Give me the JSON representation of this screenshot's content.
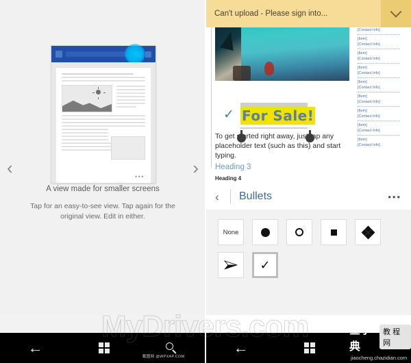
{
  "left_panel": {
    "tour": {
      "caption": "A view made for smaller screens",
      "subtext": "Tap for an easy-to-see view. Tap again for the original view. Edit in either.",
      "prev_arrow": "‹",
      "next_arrow": "›",
      "device_overflow": "•••"
    },
    "navbar": {
      "back": "←",
      "start_icon": "windows-icon",
      "search_icon": "search-icon"
    },
    "watermark_small": "截图网 @WPXAP.COM"
  },
  "right_panel": {
    "notification": {
      "message": "Can't upload - Please sign into...",
      "expand_icon": "chevron-down-icon"
    },
    "document": {
      "title_text": "For Sale!",
      "bullet_glyph": "✓",
      "body_text": "To get started right away, just tap any placeholder text (such as this) and start typing.",
      "heading3": "Heading 3",
      "heading4": "Heading 4",
      "sidebar_entries": [
        "[Contact Info]",
        "[Item]",
        "[Contact Info]",
        "[Item]",
        "[Contact Info]",
        "[Item]",
        "[Contact Info]",
        "[Item]",
        "[Contact Info]",
        "[Item]",
        "[Contact Info]",
        "[Item]",
        "[Contact Info]",
        "[Item]",
        "[Contact Info]",
        "[Item]",
        "[Contact Info]"
      ]
    },
    "bullets_pane": {
      "back_icon": "‹",
      "title": "Bullets",
      "overflow": "•••",
      "options_row1": [
        {
          "label": "None",
          "icon": "none-option"
        },
        {
          "label": "",
          "icon": "filled-circle-bullet"
        },
        {
          "label": "",
          "icon": "hollow-circle-bullet"
        },
        {
          "label": "",
          "icon": "filled-square-bullet"
        },
        {
          "label": "",
          "icon": "diamond-cluster-bullet"
        }
      ],
      "options_row2": [
        {
          "label": "",
          "icon": "arrow-bullet"
        },
        {
          "label": "",
          "icon": "checkmark-bullet",
          "glyph": "✓",
          "selected": true
        }
      ]
    },
    "navbar": {
      "back": "←",
      "start_icon": "windows-icon"
    },
    "watermark_cn_1": "查字典",
    "watermark_cn_2": "教程网",
    "watermark_cn_url": "jiaocheng.chazidian.com"
  },
  "watermark_overlay": "MyDrivers.com",
  "colors": {
    "notification_bg": "#f6dc97",
    "notification_btn": "#eccc72",
    "device_titlebar": "#1f4fa8",
    "tap_highlight": "#00bff0",
    "accent_blue": "#3d6a9c",
    "highlight_yellow": "#f0e300",
    "navbar_bg": "#000000"
  }
}
